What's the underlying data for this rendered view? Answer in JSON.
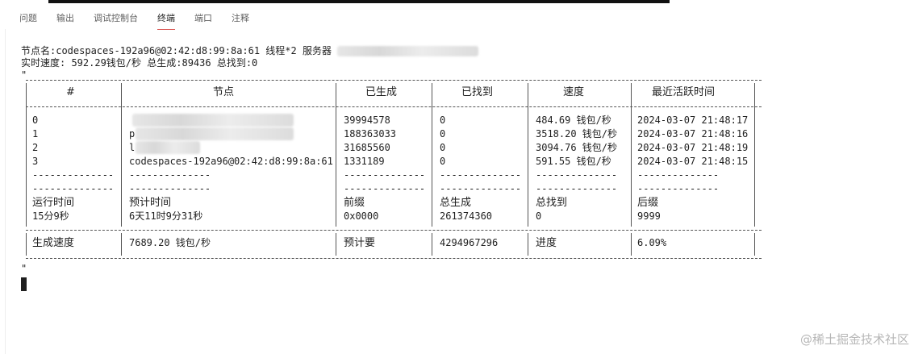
{
  "tabs": [
    {
      "label": "问题",
      "active": false
    },
    {
      "label": "输出",
      "active": false
    },
    {
      "label": "调试控制台",
      "active": false
    },
    {
      "label": "终端",
      "active": true
    },
    {
      "label": "端口",
      "active": false
    },
    {
      "label": "注释",
      "active": false
    }
  ],
  "terminal": {
    "line1_prefix": "节点名:codespaces-192a96@02:42:d8:99:8a:61 线程*2 服务器",
    "line2": "实时速度: 592.29钱包/秒 总生成:89436 总找到:0",
    "quote_open": "\"",
    "quote_close": "\""
  },
  "table": {
    "headers": [
      "#",
      "节点",
      "已生成",
      "已找到",
      "速度",
      "最近活跃时间"
    ],
    "rows": [
      {
        "id": "0",
        "node": "",
        "generated": "39994578",
        "found": "0",
        "speed": "484.69 钱包/秒",
        "last_active": "2024-03-07 21:48:17"
      },
      {
        "id": "1",
        "node": "p",
        "generated": "188363033",
        "found": "0",
        "speed": "3518.20 钱包/秒",
        "last_active": "2024-03-07 21:48:16"
      },
      {
        "id": "2",
        "node": "l",
        "generated": "31685560",
        "found": "0",
        "speed": "3094.76 钱包/秒",
        "last_active": "2024-03-07 21:48:19"
      },
      {
        "id": "3",
        "node": "codespaces-192a96@02:42:d8:99:8a:61",
        "generated": "1331189",
        "found": "0",
        "speed": "591.55 钱包/秒",
        "last_active": "2024-03-07 21:48:15"
      }
    ],
    "separator": "--------------",
    "summary_labels": [
      "运行时间",
      "预计时间",
      "前缀",
      "总生成",
      "总找到",
      "后缀"
    ],
    "summary_values": [
      "15分9秒",
      "6天11时9分31秒",
      "0x0000",
      "261374360",
      "0",
      "9999"
    ],
    "footer": [
      "生成速度",
      "7689.20 钱包/秒",
      "预计要",
      "4294967296",
      "进度",
      "6.09%"
    ]
  },
  "watermark": "@稀土掘金技术社区"
}
